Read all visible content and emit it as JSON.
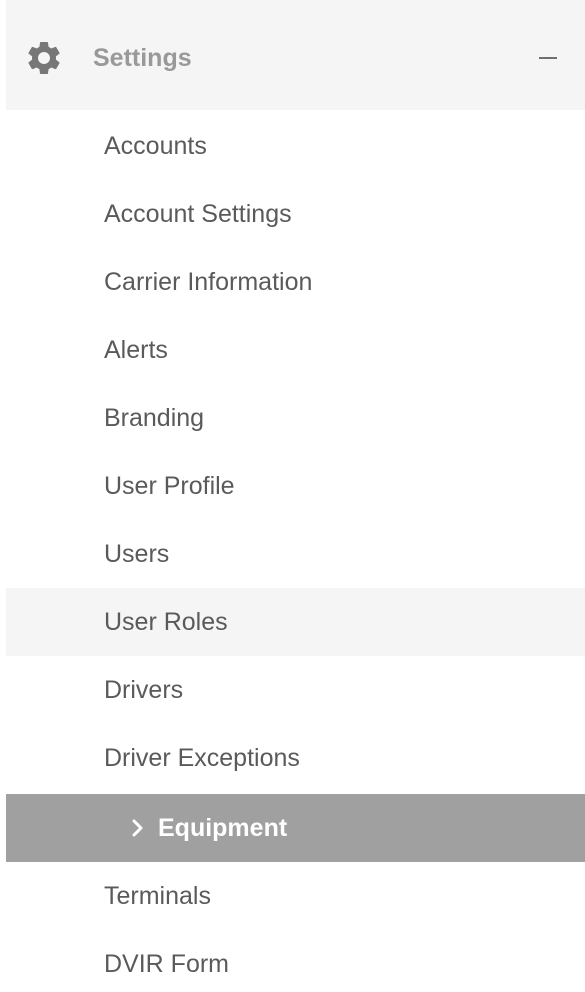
{
  "settings_section": {
    "title": "Settings",
    "icon": "gear-icon",
    "toggle_icon": "collapse-icon"
  },
  "menu": {
    "items": [
      {
        "label": "Accounts"
      },
      {
        "label": "Account Settings"
      },
      {
        "label": "Carrier Information"
      },
      {
        "label": "Alerts"
      },
      {
        "label": "Branding"
      },
      {
        "label": "User Profile"
      },
      {
        "label": "Users"
      },
      {
        "label": "User Roles"
      },
      {
        "label": "Drivers"
      },
      {
        "label": "Driver Exceptions"
      },
      {
        "label": "Equipment"
      },
      {
        "label": "Terminals"
      },
      {
        "label": "DVIR Form"
      }
    ],
    "active_item": "Equipment",
    "hovered_item": "User Roles"
  },
  "colors": {
    "active_background": "#a0a0a0",
    "hover_background": "#f5f5f5",
    "section_background": "#f5f5f5",
    "text": "#5a5a5a",
    "header_text": "#999999"
  }
}
